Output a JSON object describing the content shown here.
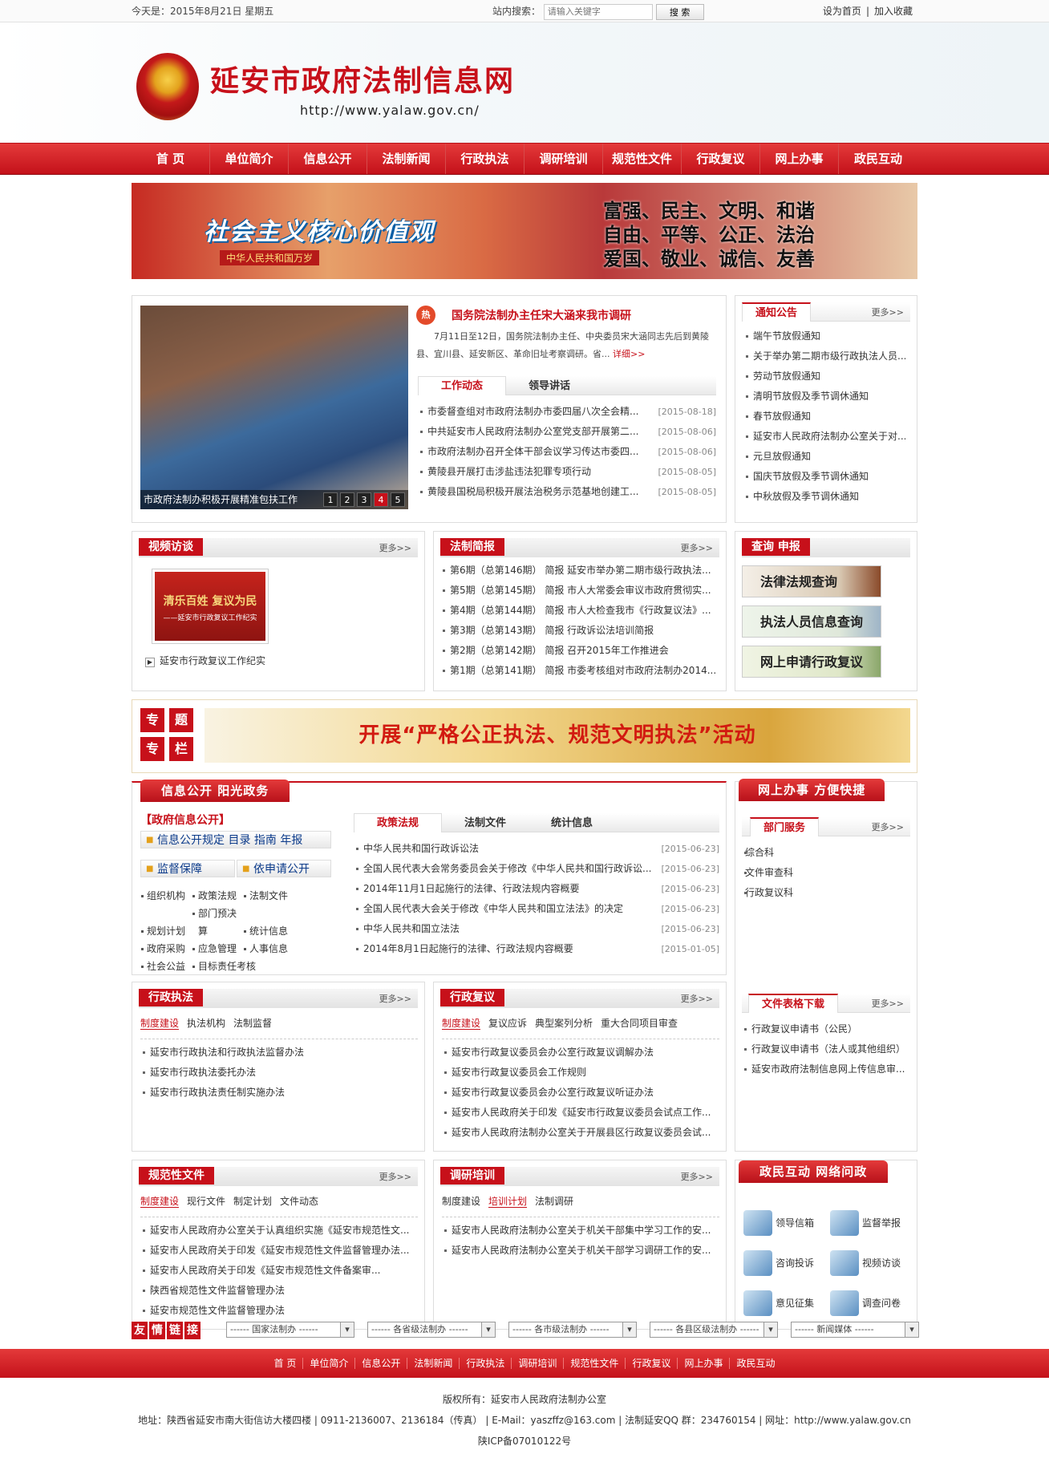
{
  "topbar": {
    "date": "今天是：2015年8月21日 星期五",
    "search_label": "站内搜索：",
    "search_placeholder": "请输入关键字",
    "search_btn": "搜 索",
    "home": "设为首页",
    "fav": "加入收藏",
    "sep": "|"
  },
  "header": {
    "title": "延安市政府法制信息网",
    "url": "http://www.yalaw.gov.cn/"
  },
  "nav": [
    "首 页",
    "单位简介",
    "信息公开",
    "法制新闻",
    "行政执法",
    "调研培训",
    "规范性文件",
    "行政复议",
    "网上办事",
    "政民互动"
  ],
  "banner1": {
    "title": "社会主义核心价值观",
    "sub": "中华人民共和国万岁",
    "vals": [
      "富强、民主、文明、和谐",
      "自由、平等、公正、法治",
      "爱国、敬业、诚信、友善"
    ]
  },
  "slide": {
    "caption": "市政府法制办积极开展精准包扶工作",
    "nums": [
      "1",
      "2",
      "3",
      "4",
      "5"
    ]
  },
  "hot": {
    "icon": "热",
    "title": "国务院法制办主任宋大涵来我市调研",
    "desc": "7月11日至12日，国务院法制办主任、中央委员宋大涵同志先后到黄陵县、宜川县、延安新区、革命旧址考察调研。省...",
    "detail": "详细>>"
  },
  "work_tabs": [
    "工作动态",
    "领导讲话"
  ],
  "work_list": [
    {
      "t": "市委督查组对市政府法制办市委四届八次全会精...",
      "d": "[2015-08-18]"
    },
    {
      "t": "中共延安市人民政府法制办公室党支部开展第二...",
      "d": "[2015-08-06]"
    },
    {
      "t": "市政府法制办召开全体干部会议学习传达市委四...",
      "d": "[2015-08-06]"
    },
    {
      "t": "黄陵县开展打击涉盐违法犯罪专项行动",
      "d": "[2015-08-05]"
    },
    {
      "t": "黄陵县国税局积极开展法治税务示范基地创建工...",
      "d": "[2015-08-05]"
    }
  ],
  "notice": {
    "title": "通知公告",
    "more": "更多>>",
    "items": [
      "端午节放假通知",
      "关于举办第二期市级行政执法人员...",
      "劳动节放假通知",
      "清明节放假及季节调休通知",
      "春节放假通知",
      "延安市人民政府法制办公室关于对...",
      "元旦放假通知",
      "国庆节放假及季节调休通知",
      "中秋放假及季节调休通知"
    ]
  },
  "video": {
    "title": "视频访谈",
    "more": "更多>>",
    "thumb_text": "清乐百姓 复议为民",
    "thumb_sub": "——延安市行政复议工作纪实",
    "caption": "延安市行政复议工作纪实"
  },
  "brief": {
    "title": "法制简报",
    "more": "更多>>",
    "items": [
      "第6期（总第146期） 简报 延安市举办第二期市级行政执法...",
      "第5期（总第145期） 简报 市人大常委会审议市政府贯彻实...",
      "第4期（总第144期） 简报 市人大检查我市《行政复议法》...",
      "第3期（总第143期） 简报 行政诉讼法培训简报",
      "第2期（总第142期） 简报 召开2015年工作推进会",
      "第1期（总第141期） 简报 市委考核组对市政府法制办2014..."
    ]
  },
  "query": {
    "title": "查询 申报",
    "btns": [
      "法律法规查询",
      "执法人员信息查询",
      "网上申请行政复议"
    ]
  },
  "special": {
    "labels": [
      "专",
      "题",
      "专",
      "栏"
    ],
    "text": "开展“严格公正执法、规范文明执法”活动"
  },
  "info": {
    "title": "信息公开 阳光政务",
    "sub": "【政府信息公开】",
    "btn1": "信息公开规定 目录 指南 年报",
    "btn2": "监督保障",
    "btn3": "依申请公开",
    "links": [
      "组织机构",
      "政策法规",
      "法制文件",
      "规划计划",
      "部门预决算",
      "统计信息",
      "政府采购",
      "应急管理",
      "人事信息",
      "社会公益",
      "目标责任考核"
    ],
    "tabs": [
      "政策法规",
      "法制文件",
      "统计信息"
    ],
    "items": [
      {
        "t": "中华人民共和国行政诉讼法",
        "d": "[2015-06-23]"
      },
      {
        "t": "全国人民代表大会常务委员会关于修改《中华人民共和国行政诉讼...",
        "d": "[2015-06-23]"
      },
      {
        "t": "2014年11月1日起施行的法律、行政法规内容概要",
        "d": "[2015-06-23]"
      },
      {
        "t": "全国人民代表大会关于修改《中华人民共和国立法法》的决定",
        "d": "[2015-06-23]"
      },
      {
        "t": "中华人民共和国立法法",
        "d": "[2015-06-23]"
      },
      {
        "t": "2014年8月1日起施行的法律、行政法规内容概要",
        "d": "[2015-01-05]"
      }
    ]
  },
  "online": {
    "title": "网上办事 方便快捷",
    "dept_title": "部门服务",
    "more": "更多>>",
    "dept": [
      "综合科",
      "文件审查科",
      "行政复议科"
    ],
    "forms_title": "文件表格下载",
    "forms": [
      "行政复议申请书（公民）",
      "行政复议申请书（法人或其他组织）",
      "延安市政府法制信息网上传信息审..."
    ]
  },
  "enforce": {
    "title": "行政执法",
    "more": "更多>>",
    "tabs": [
      "制度建设",
      "执法机构",
      "法制监督"
    ],
    "items": [
      "延安市行政执法和行政执法监督办法",
      "延安市行政执法委托办法",
      "延安市行政执法责任制实施办法"
    ]
  },
  "review": {
    "title": "行政复议",
    "more": "更多>>",
    "tabs": [
      "制度建设",
      "复议应诉",
      "典型案列分析",
      "重大合同项目审查"
    ],
    "items": [
      "延安市行政复议委员会办公室行政复议调解办法",
      "延安市行政复议委员会工作规则",
      "延安市行政复议委员会办公室行政复议听证办法",
      "延安市人民政府关于印发《延安市行政复议委员会试点工作...",
      "延安市人民政府法制办公室关于开展县区行政复议委员会试..."
    ]
  },
  "norm": {
    "title": "规范性文件",
    "more": "更多>>",
    "tabs": [
      "制度建设",
      "现行文件",
      "制定计划",
      "文件动态"
    ],
    "items": [
      "延安市人民政府办公室关于认真组织实施《延安市规范性文...",
      "延安市人民政府关于印发《延安市规范性文件监督管理办法...",
      "延安市人民政府关于印发《延安市规范性文件备案审...",
      "陕西省规范性文件监督管理办法",
      "延安市规范性文件监督管理办法"
    ]
  },
  "train": {
    "title": "调研培训",
    "more": "更多>>",
    "tabs": [
      "制度建设",
      "培训计划",
      "法制调研"
    ],
    "items": [
      "延安市人民政府法制办公室关于机关干部集中学习工作的安...",
      "延安市人民政府法制办公室关于机关干部学习调研工作的安..."
    ]
  },
  "interact": {
    "title": "政民互动 网络问政",
    "items": [
      "领导信箱",
      "监督举报",
      "咨询投诉",
      "视频访谈",
      "意见征集",
      "调查问卷"
    ]
  },
  "friend": {
    "labels": [
      "友",
      "情",
      "链",
      "接"
    ],
    "selects": [
      "------ 国家法制办 ------",
      "------ 各省级法制办 ------",
      "------ 各市级法制办 ------",
      "------ 各县区级法制办 ------",
      "------ 新闻媒体 ------"
    ]
  },
  "footer": {
    "nav": [
      "首 页",
      "单位简介",
      "信息公开",
      "法制新闻",
      "行政执法",
      "调研培训",
      "规范性文件",
      "行政复议",
      "网上办事",
      "政民互动"
    ],
    "copyright": "版权所有：延安市人民政府法制办公室",
    "address": "地址：陕西省延安市南大街信访大楼四楼 | 0911-2136007、2136184（传真） | E-Mail：yaszffz@163.com | 法制延安QQ 群：234760154 | 网址：http://www.yalaw.gov.cn",
    "icp": "陕ICP备07010122号"
  }
}
